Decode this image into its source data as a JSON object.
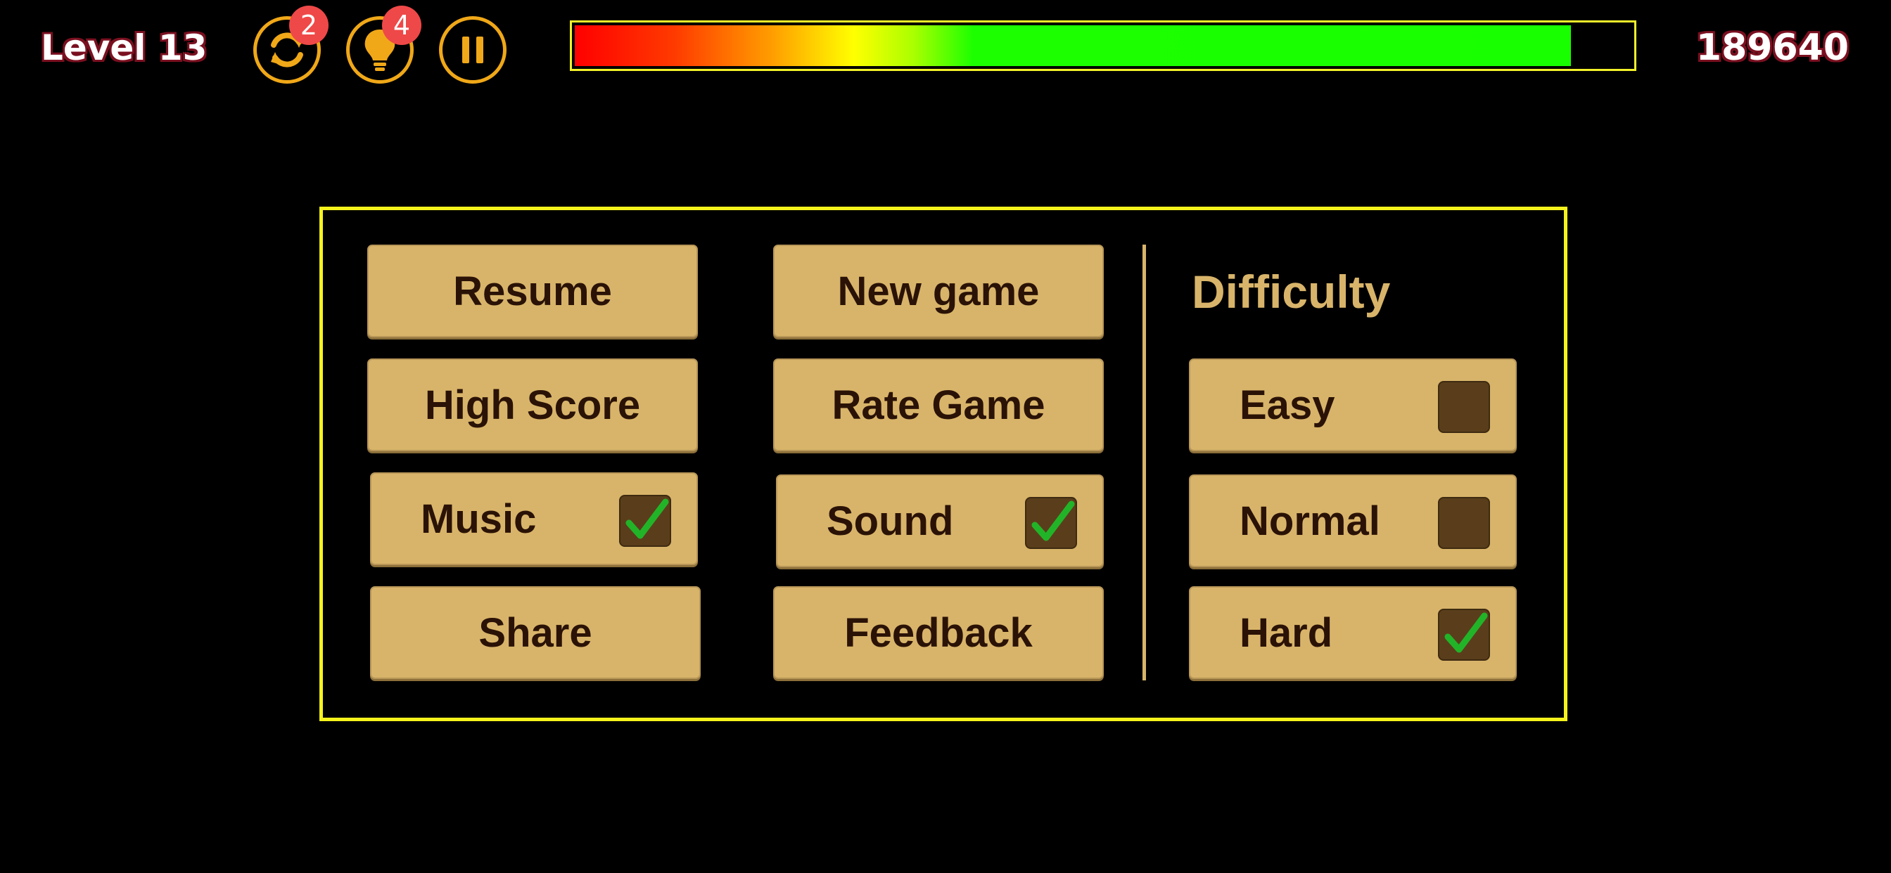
{
  "hud": {
    "level": "Level 13",
    "score": "189640",
    "restart_badge": "2",
    "hint_badge": "4",
    "timer_fill_fraction": 0.943
  },
  "colors": {
    "panel_border": "#f5f21c",
    "button_bg": "#d8b46a",
    "button_text": "#2a1206",
    "checkbox_bg": "#5a3e1b",
    "check_mark": "#22b428",
    "hud_ring": "#f0a818",
    "badge": "#ef4848"
  },
  "menu": {
    "resume": "Resume",
    "new_game": "New game",
    "high_score": "High Score",
    "rate_game": "Rate Game",
    "music": {
      "label": "Music",
      "checked": true
    },
    "sound": {
      "label": "Sound",
      "checked": true
    },
    "share": "Share",
    "feedback": "Feedback"
  },
  "difficulty": {
    "title": "Difficulty",
    "options": [
      {
        "label": "Easy",
        "checked": false
      },
      {
        "label": "Normal",
        "checked": false
      },
      {
        "label": "Hard",
        "checked": true
      }
    ]
  },
  "icons": {
    "restart": "restart-icon",
    "hint": "lightbulb-icon",
    "pause": "pause-icon",
    "check": "checkmark-icon"
  }
}
